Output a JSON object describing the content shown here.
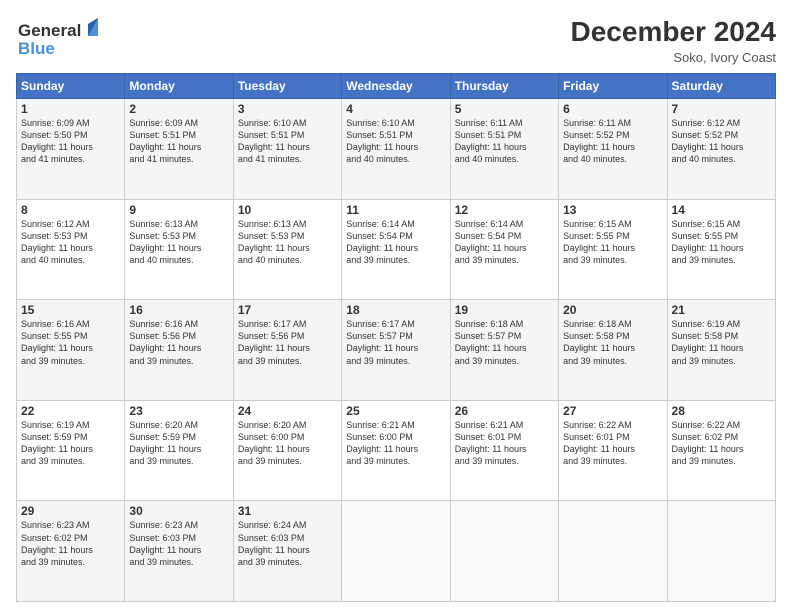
{
  "header": {
    "logo_line1": "General",
    "logo_line2": "Blue",
    "month_title": "December 2024",
    "location": "Soko, Ivory Coast"
  },
  "days_of_week": [
    "Sunday",
    "Monday",
    "Tuesday",
    "Wednesday",
    "Thursday",
    "Friday",
    "Saturday"
  ],
  "weeks": [
    [
      {
        "day": "1",
        "info": "Sunrise: 6:09 AM\nSunset: 5:50 PM\nDaylight: 11 hours\nand 41 minutes."
      },
      {
        "day": "2",
        "info": "Sunrise: 6:09 AM\nSunset: 5:51 PM\nDaylight: 11 hours\nand 41 minutes."
      },
      {
        "day": "3",
        "info": "Sunrise: 6:10 AM\nSunset: 5:51 PM\nDaylight: 11 hours\nand 41 minutes."
      },
      {
        "day": "4",
        "info": "Sunrise: 6:10 AM\nSunset: 5:51 PM\nDaylight: 11 hours\nand 40 minutes."
      },
      {
        "day": "5",
        "info": "Sunrise: 6:11 AM\nSunset: 5:51 PM\nDaylight: 11 hours\nand 40 minutes."
      },
      {
        "day": "6",
        "info": "Sunrise: 6:11 AM\nSunset: 5:52 PM\nDaylight: 11 hours\nand 40 minutes."
      },
      {
        "day": "7",
        "info": "Sunrise: 6:12 AM\nSunset: 5:52 PM\nDaylight: 11 hours\nand 40 minutes."
      }
    ],
    [
      {
        "day": "8",
        "info": "Sunrise: 6:12 AM\nSunset: 5:53 PM\nDaylight: 11 hours\nand 40 minutes."
      },
      {
        "day": "9",
        "info": "Sunrise: 6:13 AM\nSunset: 5:53 PM\nDaylight: 11 hours\nand 40 minutes."
      },
      {
        "day": "10",
        "info": "Sunrise: 6:13 AM\nSunset: 5:53 PM\nDaylight: 11 hours\nand 40 minutes."
      },
      {
        "day": "11",
        "info": "Sunrise: 6:14 AM\nSunset: 5:54 PM\nDaylight: 11 hours\nand 39 minutes."
      },
      {
        "day": "12",
        "info": "Sunrise: 6:14 AM\nSunset: 5:54 PM\nDaylight: 11 hours\nand 39 minutes."
      },
      {
        "day": "13",
        "info": "Sunrise: 6:15 AM\nSunset: 5:55 PM\nDaylight: 11 hours\nand 39 minutes."
      },
      {
        "day": "14",
        "info": "Sunrise: 6:15 AM\nSunset: 5:55 PM\nDaylight: 11 hours\nand 39 minutes."
      }
    ],
    [
      {
        "day": "15",
        "info": "Sunrise: 6:16 AM\nSunset: 5:55 PM\nDaylight: 11 hours\nand 39 minutes."
      },
      {
        "day": "16",
        "info": "Sunrise: 6:16 AM\nSunset: 5:56 PM\nDaylight: 11 hours\nand 39 minutes."
      },
      {
        "day": "17",
        "info": "Sunrise: 6:17 AM\nSunset: 5:56 PM\nDaylight: 11 hours\nand 39 minutes."
      },
      {
        "day": "18",
        "info": "Sunrise: 6:17 AM\nSunset: 5:57 PM\nDaylight: 11 hours\nand 39 minutes."
      },
      {
        "day": "19",
        "info": "Sunrise: 6:18 AM\nSunset: 5:57 PM\nDaylight: 11 hours\nand 39 minutes."
      },
      {
        "day": "20",
        "info": "Sunrise: 6:18 AM\nSunset: 5:58 PM\nDaylight: 11 hours\nand 39 minutes."
      },
      {
        "day": "21",
        "info": "Sunrise: 6:19 AM\nSunset: 5:58 PM\nDaylight: 11 hours\nand 39 minutes."
      }
    ],
    [
      {
        "day": "22",
        "info": "Sunrise: 6:19 AM\nSunset: 5:59 PM\nDaylight: 11 hours\nand 39 minutes."
      },
      {
        "day": "23",
        "info": "Sunrise: 6:20 AM\nSunset: 5:59 PM\nDaylight: 11 hours\nand 39 minutes."
      },
      {
        "day": "24",
        "info": "Sunrise: 6:20 AM\nSunset: 6:00 PM\nDaylight: 11 hours\nand 39 minutes."
      },
      {
        "day": "25",
        "info": "Sunrise: 6:21 AM\nSunset: 6:00 PM\nDaylight: 11 hours\nand 39 minutes."
      },
      {
        "day": "26",
        "info": "Sunrise: 6:21 AM\nSunset: 6:01 PM\nDaylight: 11 hours\nand 39 minutes."
      },
      {
        "day": "27",
        "info": "Sunrise: 6:22 AM\nSunset: 6:01 PM\nDaylight: 11 hours\nand 39 minutes."
      },
      {
        "day": "28",
        "info": "Sunrise: 6:22 AM\nSunset: 6:02 PM\nDaylight: 11 hours\nand 39 minutes."
      }
    ],
    [
      {
        "day": "29",
        "info": "Sunrise: 6:23 AM\nSunset: 6:02 PM\nDaylight: 11 hours\nand 39 minutes."
      },
      {
        "day": "30",
        "info": "Sunrise: 6:23 AM\nSunset: 6:03 PM\nDaylight: 11 hours\nand 39 minutes."
      },
      {
        "day": "31",
        "info": "Sunrise: 6:24 AM\nSunset: 6:03 PM\nDaylight: 11 hours\nand 39 minutes."
      },
      {
        "day": "",
        "info": ""
      },
      {
        "day": "",
        "info": ""
      },
      {
        "day": "",
        "info": ""
      },
      {
        "day": "",
        "info": ""
      }
    ]
  ]
}
